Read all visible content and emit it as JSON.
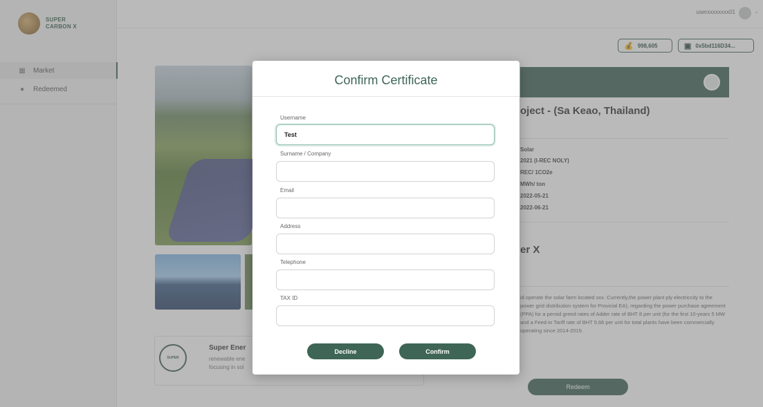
{
  "brand": {
    "line1": "SUPER",
    "line2": "CARBON X"
  },
  "sidebar": {
    "items": [
      {
        "label": "Market"
      },
      {
        "label": "Redeemed"
      }
    ]
  },
  "topbar": {
    "username": "userxxxxxxxx01"
  },
  "wallet": {
    "balance": "998,605",
    "address": "0x5bd116D34..."
  },
  "project": {
    "title": "oject - (Sa Keao, Thailand)",
    "specs": [
      "Solar",
      "2021 (I-REC NOLY)",
      "REC/ 1CO2e",
      "MWh/ ton",
      "2022-05-21",
      "2022-06-21"
    ],
    "owner_title": "er X",
    "description": "id operate the solar farm located xxx. Currently,the power plant ply electriccity to the power grid distribution system for Provicial EA), regarding the power purchase agreement (PPA) for a peroid greed rates of Adder rate of BHT 8 per unit (for the first 10-years 5 MW and a Feed-in Tariff rate of BHT 5.66 per unit for total plants have been commercially operating since 2014-2015.",
    "redeem_label": "Redeem"
  },
  "org": {
    "name": "Super Ener",
    "desc": "renewable ene focusing in sol",
    "logo_text": "SUPER"
  },
  "modal": {
    "title": "Confirm Certificate",
    "fields": [
      {
        "label": "Username",
        "value": "Test"
      },
      {
        "label": "Surname / Company",
        "value": ""
      },
      {
        "label": "Email",
        "value": ""
      },
      {
        "label": "Address",
        "value": ""
      },
      {
        "label": "Telephone",
        "value": ""
      },
      {
        "label": "TAX ID",
        "value": ""
      }
    ],
    "decline_label": "Decline",
    "confirm_label": "Confirm"
  },
  "colors": {
    "accent": "#3e6556",
    "overlay": "rgba(110,110,110,0.48)"
  }
}
